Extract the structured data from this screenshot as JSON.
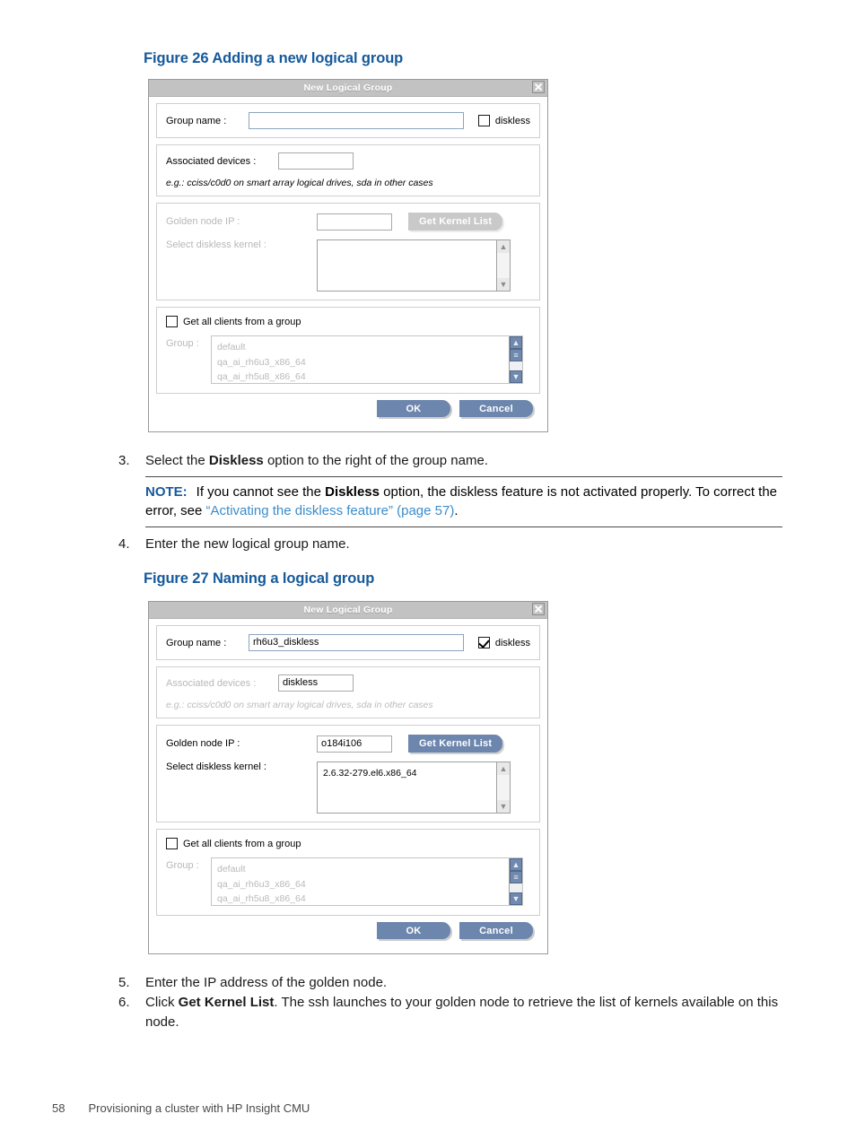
{
  "page": {
    "number": "58",
    "running_head": "Provisioning a cluster with HP Insight CMU"
  },
  "figures": [
    {
      "caption": "Figure 26 Adding a new logical group",
      "dialog": {
        "title": "New Logical Group",
        "close_icon": "close-icon",
        "group_name_label": "Group name :",
        "group_name_value": "",
        "diskless_label": "diskless",
        "diskless_checked": false,
        "associated_devices_label": "Associated devices :",
        "associated_devices_value": "",
        "associated_devices_disabled": false,
        "hint": "e.g.: cciss/c0d0 on smart array logical drives, sda in other cases",
        "hint_disabled": false,
        "golden_node_label": "Golden node IP :",
        "golden_node_value": "",
        "golden_node_disabled": true,
        "get_kernel_label": "Get Kernel List",
        "get_kernel_disabled": true,
        "select_kernel_label": "Select diskless kernel :",
        "select_kernel_disabled": true,
        "kernels": [],
        "get_all_clients_label": "Get all clients from a group",
        "get_all_clients_checked": false,
        "group_label": "Group :",
        "groups": [
          "default",
          "qa_ai_rh6u3_x86_64",
          "qa_ai_rh5u8_x86_64"
        ],
        "ok_label": "OK",
        "cancel_label": "Cancel"
      }
    },
    {
      "caption": "Figure 27 Naming a logical group",
      "dialog": {
        "title": "New Logical Group",
        "close_icon": "close-icon",
        "group_name_label": "Group name :",
        "group_name_value": "rh6u3_diskless",
        "diskless_label": "diskless",
        "diskless_checked": true,
        "associated_devices_label": "Associated devices :",
        "associated_devices_value": "diskless",
        "associated_devices_disabled": true,
        "hint": "e.g.: cciss/c0d0 on smart array logical drives, sda in other cases",
        "hint_disabled": true,
        "golden_node_label": "Golden node IP :",
        "golden_node_value": "o184i106",
        "golden_node_disabled": false,
        "get_kernel_label": "Get Kernel List",
        "get_kernel_disabled": false,
        "select_kernel_label": "Select diskless kernel :",
        "select_kernel_disabled": false,
        "kernels": [
          "2.6.32-279.el6.x86_64"
        ],
        "get_all_clients_label": "Get all clients from a group",
        "get_all_clients_checked": false,
        "group_label": "Group :",
        "groups": [
          "default",
          "qa_ai_rh6u3_x86_64",
          "qa_ai_rh5u8_x86_64"
        ],
        "ok_label": "OK",
        "cancel_label": "Cancel"
      }
    }
  ],
  "steps": {
    "s3_num": "3.",
    "s3_a": "Select the ",
    "s3_b": "Diskless",
    "s3_c": " option to the right of the group name.",
    "note_label": "NOTE:",
    "note_a": "If you cannot see the ",
    "note_b": "Diskless",
    "note_c": " option, the diskless feature is not activated properly. To correct the error, see ",
    "note_link": "“Activating the diskless feature” (page 57)",
    "note_d": ".",
    "s4_num": "4.",
    "s4_text": "Enter the new logical group name.",
    "s5_num": "5.",
    "s5_text": "Enter the IP address of the golden node.",
    "s6_num": "6.",
    "s6_a": "Click ",
    "s6_b": "Get Kernel List",
    "s6_c": ". The ssh launches to your golden node to retrieve the list of kernels available on this node."
  },
  "colors": {
    "caption": "#15599b",
    "link": "#3b8ccb",
    "button": "#6d86ad",
    "titlebar": "#c2c2c2"
  }
}
